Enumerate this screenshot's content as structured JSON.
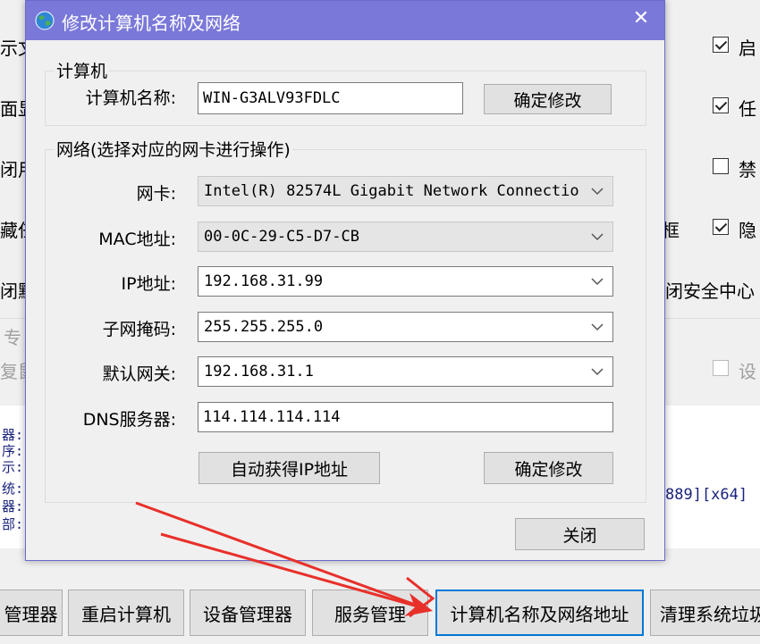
{
  "background": {
    "left_fragments": [
      "示文",
      "面显",
      "闭用",
      "藏任",
      "闭默",
      "专",
      "复鼠"
    ],
    "right_options": [
      {
        "label": "启",
        "checked": true,
        "disabled": false
      },
      {
        "label": "任",
        "checked": true,
        "disabled": false
      },
      {
        "label": "禁",
        "checked": false,
        "disabled": false
      },
      {
        "label": "隐",
        "checked": true,
        "disabled": false
      },
      {
        "label": "设",
        "checked": false,
        "disabled": true
      }
    ],
    "mid_fragment": "框",
    "security_center_fragment": "闭安全中心",
    "info_chars": [
      "器:",
      "序:",
      "示:",
      "统:",
      "器:",
      "部:"
    ],
    "build_fragment": "889][x64]",
    "bottom_buttons": [
      "管理器",
      "重启计算机",
      "设备管理器",
      "服务管理",
      "计算机名称及网络地址",
      "清理系统垃圾"
    ]
  },
  "dialog": {
    "title": "修改计算机名称及网络",
    "close_glyph": "✕",
    "computer_group": {
      "title": "计算机",
      "name_label": "计算机名称:",
      "name_value": "WIN-G3ALV93FDLC",
      "confirm_label": "确定修改"
    },
    "network_group": {
      "title": "网络(选择对应的网卡进行操作)",
      "nic_label": "网卡:",
      "nic_value": "Intel(R) 82574L Gigabit Network Connectio",
      "mac_label": "MAC地址:",
      "mac_value": "00-0C-29-C5-D7-CB",
      "ip_label": "IP地址:",
      "ip_value": "192.168.31.99",
      "mask_label": "子网掩码:",
      "mask_value": "255.255.255.0",
      "gateway_label": "默认网关:",
      "gateway_value": "192.168.31.1",
      "dns_label": "DNS服务器:",
      "dns_value": "114.114.114.114",
      "auto_ip_label": "自动获得IP地址",
      "confirm_label": "确定修改"
    },
    "close_label": "关闭"
  },
  "colors": {
    "titlebar": "#7a78d8",
    "annotation_arrow": "#e8302a",
    "focus_border": "#0078d7"
  }
}
